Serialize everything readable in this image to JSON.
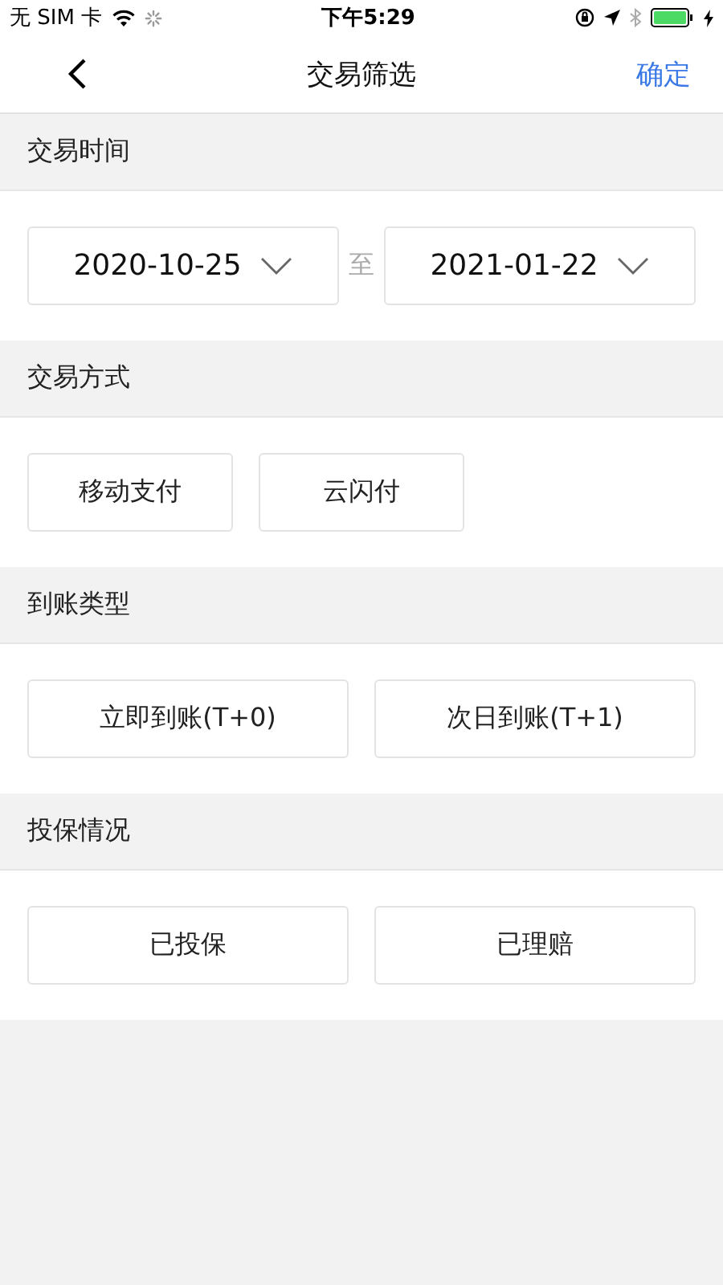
{
  "status_bar": {
    "carrier": "无 SIM 卡",
    "time": "下午5:29"
  },
  "nav": {
    "title": "交易筛选",
    "action": "确定"
  },
  "sections": [
    {
      "kind": "date_range",
      "title": "交易时间",
      "start": "2020-10-25",
      "separator": "至",
      "end": "2021-01-22"
    },
    {
      "kind": "chips",
      "title": "交易方式",
      "options": [
        {
          "label": "移动支付",
          "selected": false
        },
        {
          "label": "云闪付",
          "selected": false
        }
      ]
    },
    {
      "kind": "pairs",
      "title": "到账类型",
      "options": [
        {
          "label": "立即到账(T+0)",
          "selected": false
        },
        {
          "label": "次日到账(T+1)",
          "selected": false
        }
      ]
    },
    {
      "kind": "pairs",
      "title": "投保情况",
      "options": [
        {
          "label": "已投保",
          "selected": false
        },
        {
          "label": "已理赔",
          "selected": false
        }
      ]
    }
  ]
}
